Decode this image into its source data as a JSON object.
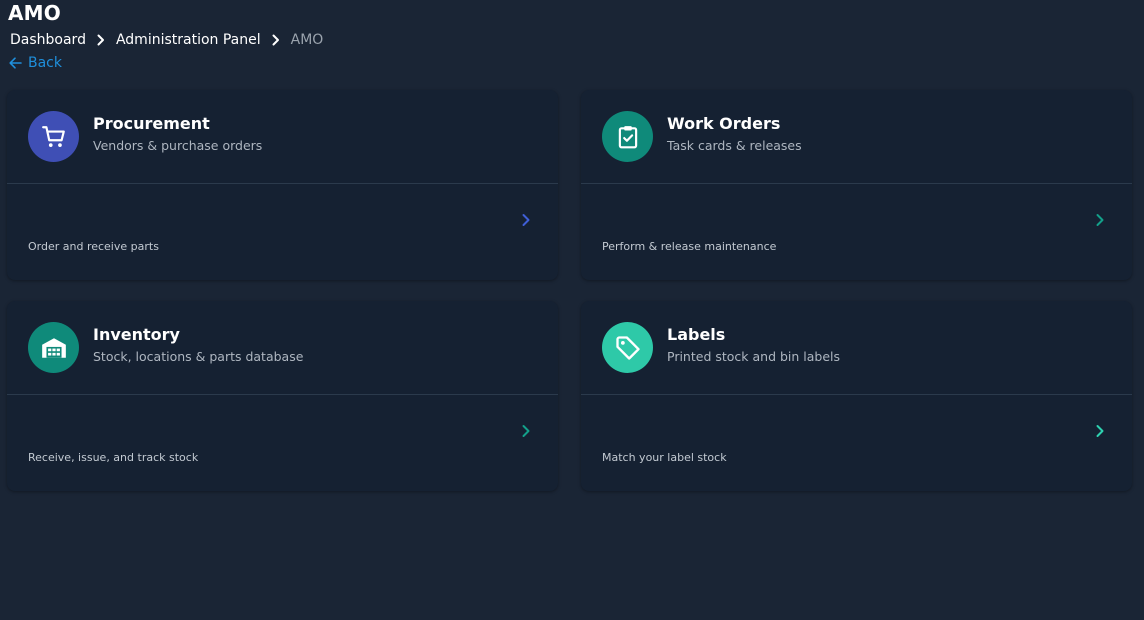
{
  "page": {
    "title": "AMO"
  },
  "breadcrumb": {
    "items": [
      "Dashboard",
      "Administration Panel",
      "AMO"
    ]
  },
  "back": {
    "label": "Back"
  },
  "cards": [
    {
      "title": "Procurement",
      "subtitle": "Vendors & purchase orders",
      "description": "Order and receive parts",
      "icon": "cart-icon",
      "icon_color": "#3f4fb5",
      "chevron_color": "#3f5fd6"
    },
    {
      "title": "Work Orders",
      "subtitle": "Task cards & releases",
      "description": "Perform & release maintenance",
      "icon": "clipboard-check-icon",
      "icon_color": "#0f8a7a",
      "chevron_color": "#13a08a"
    },
    {
      "title": "Inventory",
      "subtitle": "Stock, locations & parts database",
      "description": "Receive, issue, and track stock",
      "icon": "warehouse-icon",
      "icon_color": "#0f8a7a",
      "chevron_color": "#13a08a"
    },
    {
      "title": "Labels",
      "subtitle": "Printed stock and bin labels",
      "description": "Match your label stock",
      "icon": "tag-icon",
      "icon_color": "#2ec9a8",
      "chevron_color": "#2ed1b0"
    }
  ],
  "colors": {
    "background": "#1a2535",
    "card": "#152132",
    "link": "#1f8fdb"
  }
}
